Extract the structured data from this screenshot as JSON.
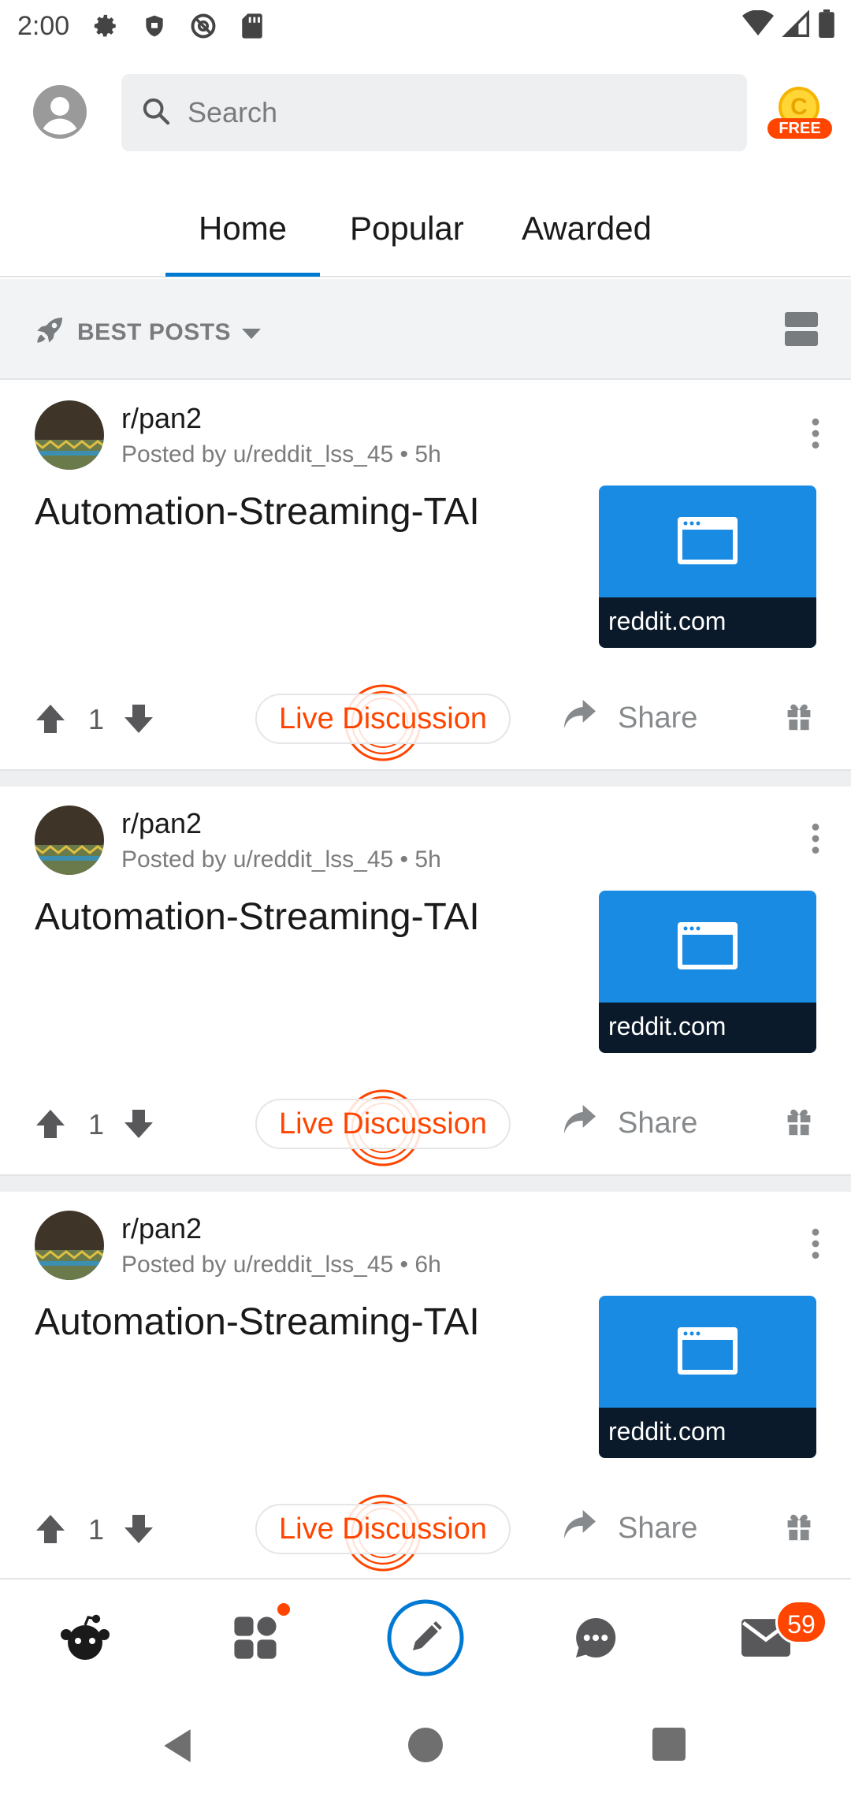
{
  "status_bar": {
    "time": "2:00"
  },
  "search": {
    "placeholder": "Search"
  },
  "coins": {
    "letter": "C",
    "free_label": "FREE"
  },
  "tabs": [
    {
      "label": "Home",
      "active": true
    },
    {
      "label": "Popular",
      "active": false
    },
    {
      "label": "Awarded",
      "active": false
    }
  ],
  "sort": {
    "label": "BEST POSTS"
  },
  "posts": [
    {
      "subreddit": "r/pan2",
      "meta": "Posted by u/reddit_lss_45 • 5h",
      "title": "Automation-Streaming-TAI",
      "domain": "reddit.com",
      "score": "1",
      "live_label": "Live Discussion",
      "share_label": "Share"
    },
    {
      "subreddit": "r/pan2",
      "meta": "Posted by u/reddit_lss_45 • 5h",
      "title": "Automation-Streaming-TAI",
      "domain": "reddit.com",
      "score": "1",
      "live_label": "Live Discussion",
      "share_label": "Share"
    },
    {
      "subreddit": "r/pan2",
      "meta": "Posted by u/reddit_lss_45 • 6h",
      "title": "Automation-Streaming-TAI",
      "domain": "reddit.com",
      "score": "1",
      "live_label": "Live Discussion",
      "share_label": "Share"
    }
  ],
  "bottom_nav": {
    "items": [
      "home-icon",
      "communities-icon",
      "create-post-icon",
      "chat-icon",
      "inbox-icon"
    ],
    "inbox_badge": "59"
  },
  "colors": {
    "accent": "#0079d3",
    "orangered": "#ff4500",
    "thumb": "#1a8be3"
  }
}
